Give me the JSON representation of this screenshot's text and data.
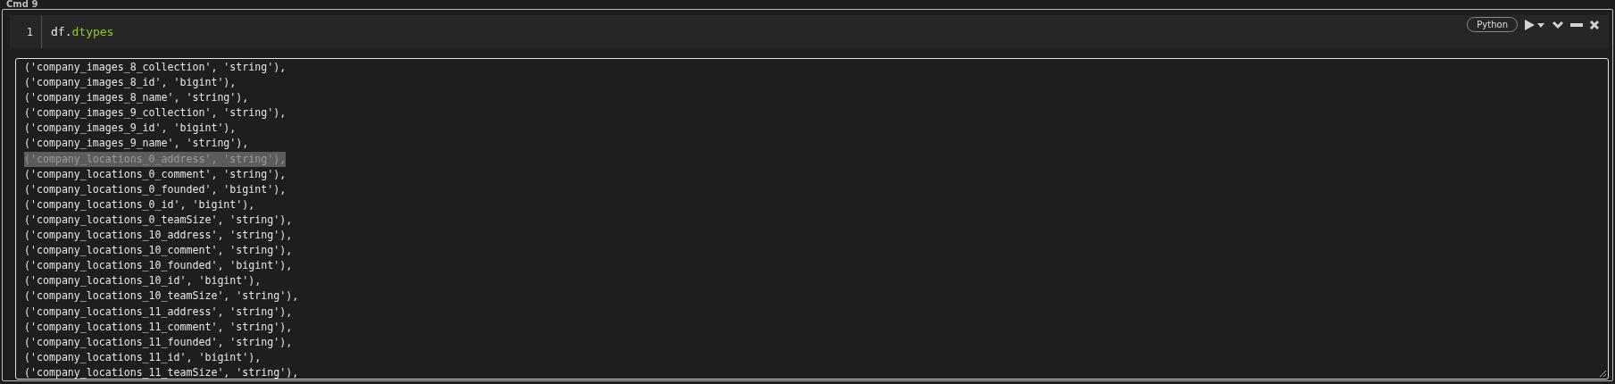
{
  "cell_label": "Cmd 9",
  "editor": {
    "line_numbers": [
      "1"
    ],
    "code": [
      {
        "text": "df.",
        "kind": "plain"
      },
      {
        "text": "dtypes",
        "kind": "attribute"
      }
    ]
  },
  "toolbar": {
    "language": "Python"
  },
  "output": {
    "lines": [
      {
        "text": "('company_images_8_collection', 'string'),",
        "selected": false
      },
      {
        "text": "('company_images_8_id', 'bigint'),",
        "selected": false
      },
      {
        "text": "('company_images_8_name', 'string'),",
        "selected": false
      },
      {
        "text": "('company_images_9_collection', 'string'),",
        "selected": false
      },
      {
        "text": "('company_images_9_id', 'bigint'),",
        "selected": false
      },
      {
        "text": "('company_images_9_name', 'string'),",
        "selected": false
      },
      {
        "text": "('company_locations_0_address', 'string'),",
        "selected": true
      },
      {
        "text": "('company_locations_0_comment', 'string'),",
        "selected": false
      },
      {
        "text": "('company_locations_0_founded', 'bigint'),",
        "selected": false
      },
      {
        "text": "('company_locations_0_id', 'bigint'),",
        "selected": false
      },
      {
        "text": "('company_locations_0_teamSize', 'string'),",
        "selected": false
      },
      {
        "text": "('company_locations_10_address', 'string'),",
        "selected": false
      },
      {
        "text": "('company_locations_10_comment', 'string'),",
        "selected": false
      },
      {
        "text": "('company_locations_10_founded', 'bigint'),",
        "selected": false
      },
      {
        "text": "('company_locations_10_id', 'bigint'),",
        "selected": false
      },
      {
        "text": "('company_locations_10_teamSize', 'string'),",
        "selected": false
      },
      {
        "text": "('company_locations_11_address', 'string'),",
        "selected": false
      },
      {
        "text": "('company_locations_11_comment', 'string'),",
        "selected": false
      },
      {
        "text": "('company_locations_11_founded', 'string'),",
        "selected": false
      },
      {
        "text": "('company_locations_11_id', 'bigint'),",
        "selected": false
      },
      {
        "text": "('company_locations_11_teamSize', 'string'),",
        "selected": false
      }
    ]
  }
}
